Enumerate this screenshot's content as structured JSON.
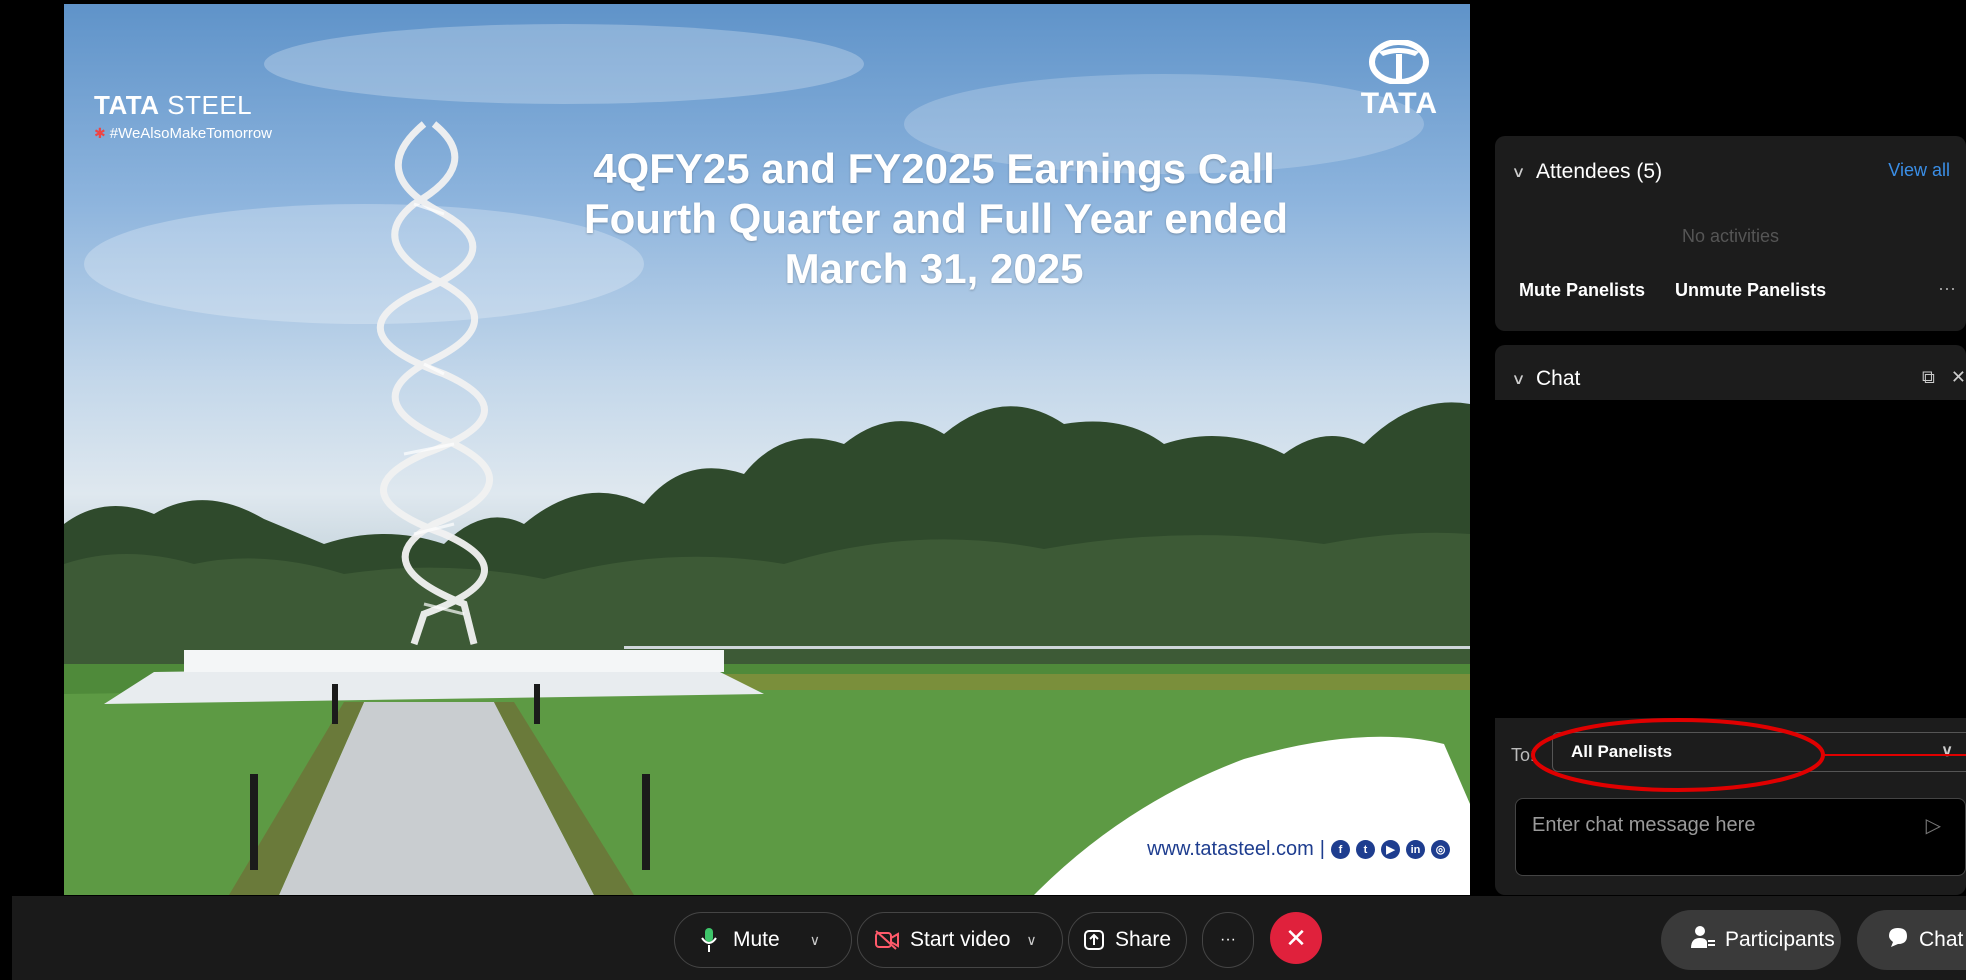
{
  "slide": {
    "brand_left_word_bold": "TATA",
    "brand_left_word_light": "STEEL",
    "brand_left_tag": "#WeAlsoMakeTomorrow",
    "brand_right_word": "TATA",
    "title_lines": [
      "4QFY25 and FY2025 Earnings Call",
      "Fourth Quarter and Full Year ended",
      "March 31, 2025"
    ],
    "footer_url": "www.tatasteel.com",
    "footer_separator": "|",
    "social_icons": [
      "facebook-icon",
      "twitter-icon",
      "youtube-icon",
      "linkedin-icon",
      "instagram-icon"
    ]
  },
  "attendees": {
    "title": "Attendees (5)",
    "view_all": "View all",
    "empty_text": "No activities",
    "mute_panelists": "Mute Panelists",
    "unmute_panelists": "Unmute Panelists",
    "more": "···"
  },
  "chat": {
    "title": "Chat",
    "to_label": "To:",
    "to_value": "All Panelists",
    "input_placeholder": "Enter chat message here"
  },
  "controls": {
    "mute": "Mute",
    "start_video": "Start video",
    "share": "Share",
    "more": "···",
    "participants": "Participants",
    "chat": "Chat"
  },
  "colors": {
    "end_call": "#e0213c",
    "link_blue": "#3a8ee6",
    "annotation_red": "#e00000",
    "tata_blue": "#1e3d8f"
  }
}
